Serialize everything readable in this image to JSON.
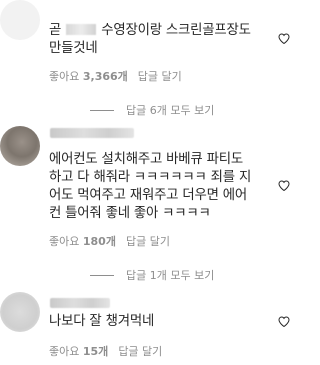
{
  "comments": [
    {
      "text_line1_pre": "곧",
      "text_line1_post": "수영장이랑 스크린골프장도",
      "text_line2": "만들것네",
      "likes_label": "좋아요",
      "likes_count": "3,366개",
      "reply_label": "답글 달기",
      "view_replies": "답글 6개 모두 보기"
    },
    {
      "text_lines": [
        "에어컨도 설치해주고 바베큐 파티도",
        "하고 다 해줘라 ㅋㅋㅋㅋㅋㅋ 죄를 지",
        "어도 먹여주고 재워주고 더우면 에어",
        "컨 틀어줘 좋네 좋아 ㅋㅋㅋㅋ"
      ],
      "likes_label": "좋아요",
      "likes_count": "180개",
      "reply_label": "답글 달기",
      "view_replies": "답글 1개 모두 보기"
    },
    {
      "text": "나보다 잘 챙겨먹네",
      "likes_label": "좋아요",
      "likes_count": "15개",
      "reply_label": "답글 달기"
    }
  ]
}
